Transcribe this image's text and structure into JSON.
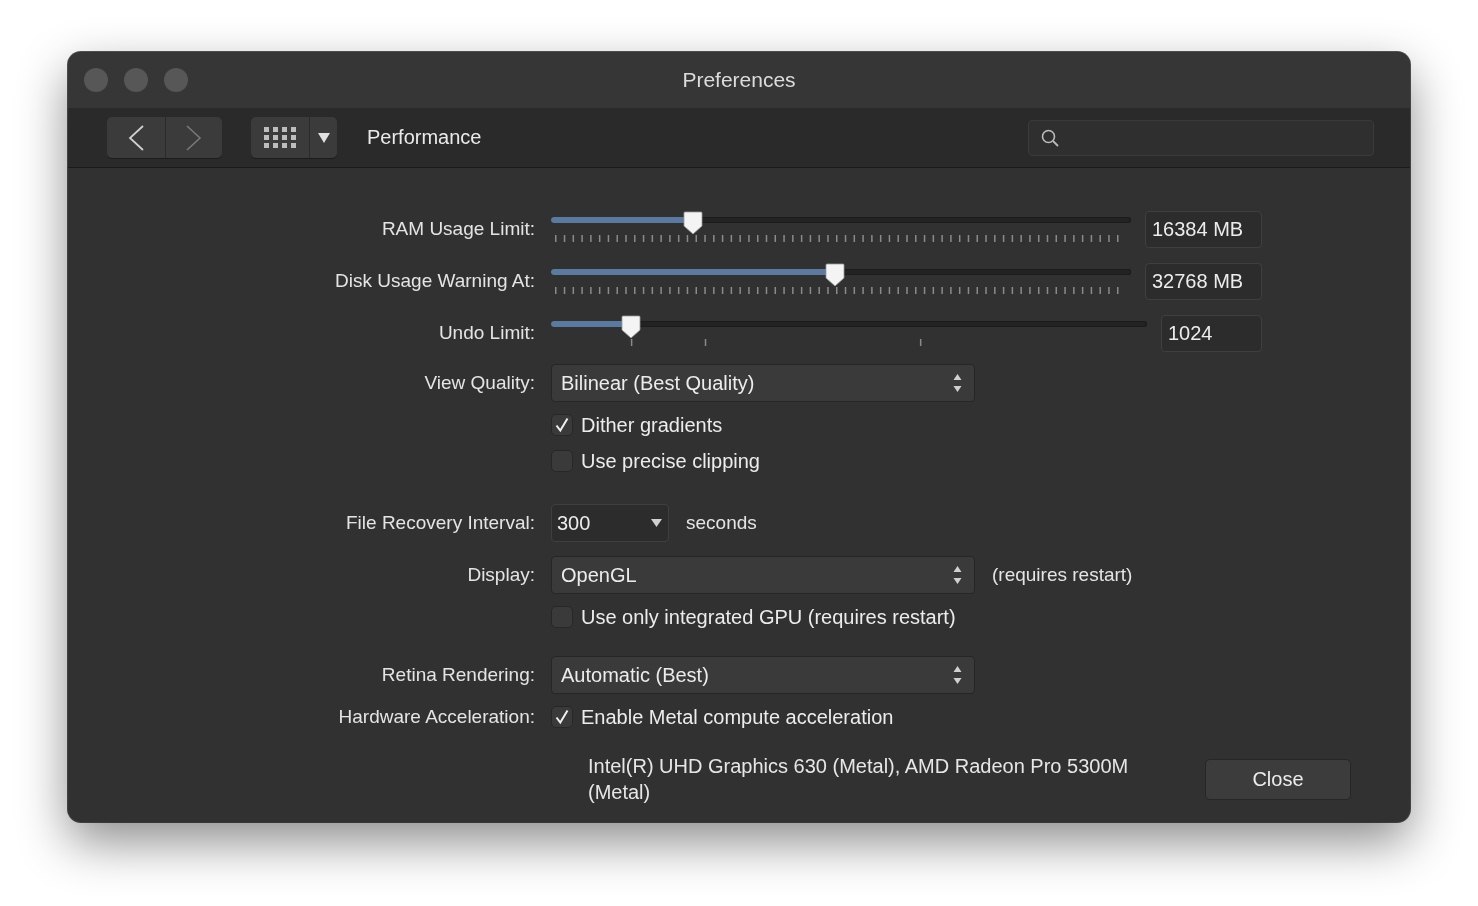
{
  "window": {
    "title": "Preferences"
  },
  "toolbar": {
    "section": "Performance"
  },
  "settings": [
    {
      "kind": "slider",
      "label": "RAM Usage Limit:",
      "level": 0.245,
      "value": "16384 MB"
    },
    {
      "kind": "slider",
      "label": "Disk Usage Warning At:",
      "level": 0.49,
      "value": "32768 MB"
    },
    {
      "kind": "stepslider",
      "label": "Undo Limit:",
      "level": 0.134,
      "value": "1024"
    },
    {
      "kind": "select",
      "label": "View Quality:",
      "value": "Bilinear (Best Quality)"
    },
    {
      "kind": "checkbox",
      "text": "Dither gradients",
      "checked": true
    },
    {
      "kind": "checkbox",
      "text": "Use precise clipping",
      "checked": false
    },
    {
      "kind": "dropdown",
      "label": "File Recovery Interval:",
      "value": "300",
      "suffix": "seconds"
    },
    {
      "kind": "select",
      "label": "Display:",
      "value": "OpenGL",
      "note": "(requires restart)"
    },
    {
      "kind": "checkbox",
      "text": "Use only integrated GPU (requires restart)",
      "checked": false
    },
    {
      "kind": "select",
      "label": "Retina Rendering:",
      "value": "Automatic (Best)"
    },
    {
      "kind": "checkbox",
      "label": "Hardware Acceleration:",
      "text": "Enable Metal compute acceleration",
      "checked": true
    }
  ],
  "footer": {
    "info": "Intel(R) UHD Graphics 630 (Metal), AMD Radeon Pro 5300M (Metal)",
    "button": "Close"
  }
}
